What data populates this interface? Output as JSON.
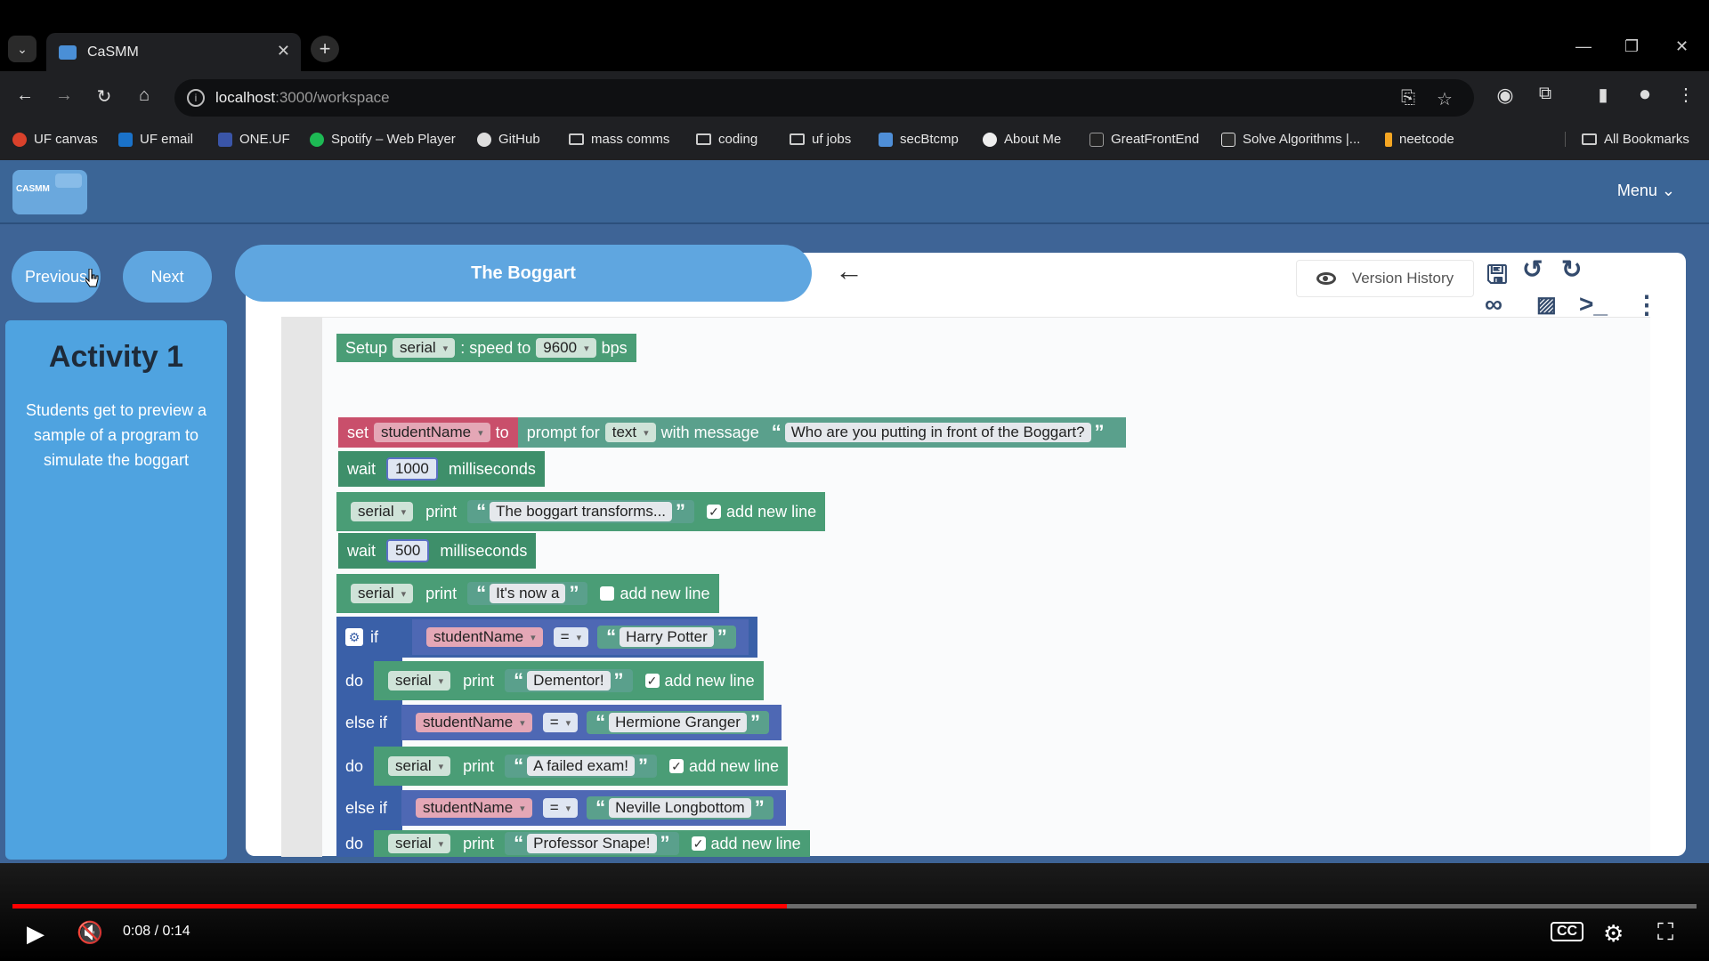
{
  "browser": {
    "tab_title": "CaSMM",
    "url_host": "localhost",
    "url_rest": ":3000/workspace",
    "bookmarks": [
      "UF canvas",
      "UF email",
      "ONE.UF",
      "Spotify – Web Player",
      "GitHub",
      "mass comms",
      "coding",
      "uf jobs",
      "secBtcmp",
      "About Me",
      "GreatFrontEnd",
      "Solve Algorithms |...",
      "neetcode",
      "All Bookmarks"
    ]
  },
  "app": {
    "logo_text": "CASMM",
    "menu_label": "Menu",
    "previous_label": "Previous",
    "next_label": "Next",
    "activity_title": "Activity 1",
    "activity_description": "Students get to preview a sample of a program to simulate the boggart",
    "lesson_title": "The Boggart",
    "version_history_label": "Version History"
  },
  "blocks": {
    "setup": {
      "kw1": "Setup",
      "port": "serial",
      "kw2": ":  speed to",
      "speed": "9600",
      "kw3": "bps"
    },
    "set_var": {
      "kw1": "set",
      "var": "studentName",
      "kw2": "to",
      "kw3": "prompt for",
      "type": "text",
      "kw4": "with message",
      "msg": "Who are you putting in front of the Boggart?"
    },
    "wait1": {
      "kw1": "wait",
      "val": "1000",
      "kw2": "milliseconds"
    },
    "print1": {
      "port": "serial",
      "kw": "print",
      "text": "The boggart transforms...",
      "newline": "add new line"
    },
    "wait2": {
      "kw1": "wait",
      "val": "500",
      "kw2": "milliseconds"
    },
    "print2": {
      "port": "serial",
      "kw": "print",
      "text": "It's now a",
      "newline": "add new line"
    },
    "if1": {
      "kw": "if",
      "var": "studentName",
      "op": "=",
      "val": "Harry Potter"
    },
    "do1": {
      "kw": "do",
      "port": "serial",
      "print": "print",
      "text": "Dementor!",
      "newline": "add new line"
    },
    "elif1": {
      "kw": "else if",
      "var": "studentName",
      "op": "=",
      "val": "Hermione Granger"
    },
    "do2": {
      "kw": "do",
      "port": "serial",
      "print": "print",
      "text": "A failed exam!",
      "newline": "add new line"
    },
    "elif2": {
      "kw": "else if",
      "var": "studentName",
      "op": "=",
      "val": "Neville Longbottom"
    },
    "do3": {
      "kw": "do",
      "port": "serial",
      "print": "print",
      "text": "Professor Snape!",
      "newline": "add new line"
    }
  },
  "player": {
    "time": "0:08 / 0:14",
    "progress": 0.46
  },
  "icons": [
    "tab-dropdown-icon",
    "close-icon",
    "plus-icon",
    "back-icon",
    "forward-icon",
    "reload-icon",
    "home-icon",
    "star-icon",
    "extensions-icon",
    "eye-icon",
    "save-icon",
    "undo-icon",
    "redo-icon",
    "arduino-icon",
    "image-icon",
    "terminal-icon",
    "more-icon",
    "play-icon",
    "mute-icon",
    "cc-icon",
    "settings-icon",
    "fullscreen-icon"
  ]
}
